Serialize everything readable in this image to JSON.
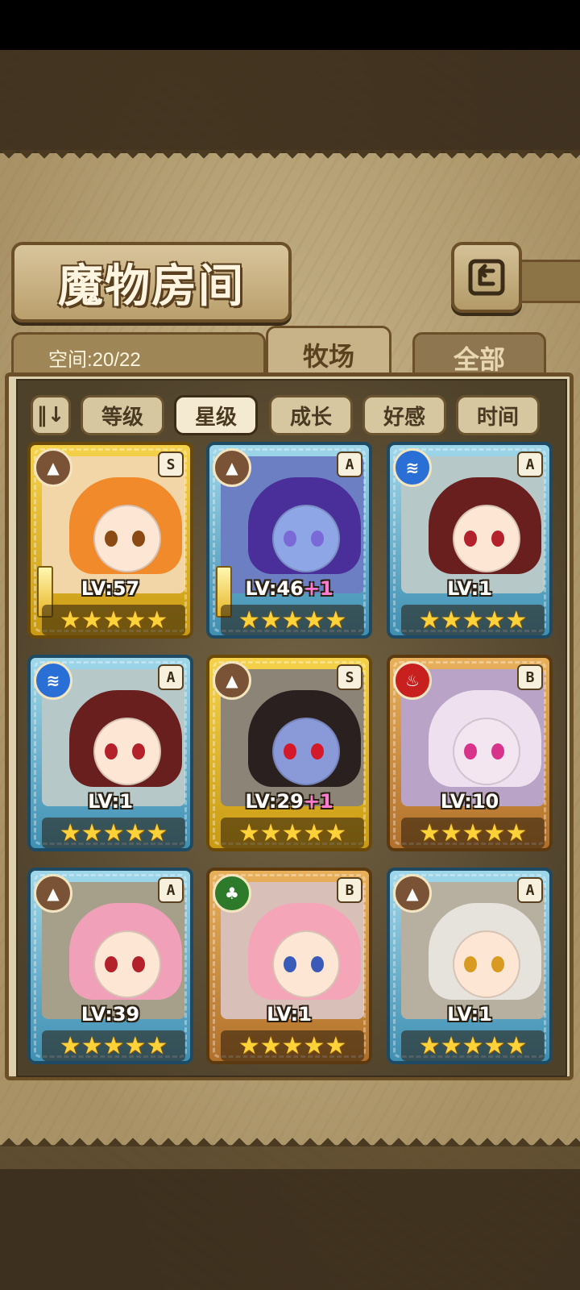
{
  "page": {
    "title": "魔物房间",
    "space_label": "空间:20/22",
    "tabs": [
      {
        "label": "牧场",
        "active": true
      },
      {
        "label": "全部",
        "active": false
      }
    ],
    "sort_buttons": [
      {
        "label": "等级",
        "active": false
      },
      {
        "label": "星级",
        "active": true
      },
      {
        "label": "成长",
        "active": false
      },
      {
        "label": "好感",
        "active": false
      },
      {
        "label": "时间",
        "active": false
      }
    ],
    "sort_toggle_icon": "sort-order-icon"
  },
  "monsters": [
    {
      "level": "LV:57",
      "bonus": "",
      "rank": "S",
      "element": "earth",
      "frame": "gold",
      "stars": "★★★★★",
      "weapon": true,
      "hair": "#f08a2a",
      "eye": "#8b4a13"
    },
    {
      "level": "LV:46",
      "bonus": "+1",
      "rank": "A",
      "element": "earth",
      "frame": "blue",
      "stars": "★★★★★",
      "weapon": true,
      "hair": "#4a2e9a",
      "eye": "#7a6ad8"
    },
    {
      "level": "LV:1",
      "bonus": "",
      "rank": "A",
      "element": "water",
      "frame": "blue",
      "stars": "★★★★★",
      "weapon": false,
      "hair": "#6a1f1f",
      "eye": "#c8202a"
    },
    {
      "level": "LV:1",
      "bonus": "",
      "rank": "A",
      "element": "water",
      "frame": "blue",
      "stars": "★★★★★",
      "weapon": false,
      "hair": "#6a1f1f",
      "eye": "#c8202a"
    },
    {
      "level": "LV:29",
      "bonus": "+1",
      "rank": "S",
      "element": "earth",
      "frame": "gold",
      "stars": "★★★★★",
      "weapon": false,
      "hair": "#2a2020",
      "eye": "#d41a2a"
    },
    {
      "level": "LV:10",
      "bonus": "",
      "rank": "B",
      "element": "fire",
      "frame": "orange",
      "stars": "★★★★★",
      "weapon": false,
      "hair": "#efe0f0",
      "eye": "#d8338a"
    },
    {
      "level": "LV:39",
      "bonus": "",
      "rank": "A",
      "element": "earth",
      "frame": "blue",
      "stars": "★★★★★",
      "weapon": false,
      "hair": "#f0a0b8",
      "eye": "#c8202a"
    },
    {
      "level": "LV:1",
      "bonus": "",
      "rank": "B",
      "element": "wood",
      "frame": "orange",
      "stars": "★★★★★",
      "weapon": false,
      "hair": "#f4a6b8",
      "eye": "#3a5ab8"
    },
    {
      "level": "LV:1",
      "bonus": "",
      "rank": "A",
      "element": "earth",
      "frame": "blue",
      "stars": "★★★★★",
      "weapon": false,
      "hair": "#e6e2dc",
      "eye": "#d89a20"
    }
  ],
  "colors": {
    "earth": "#7a5236",
    "water": "#2a6fd6",
    "fire": "#c81f1f",
    "wood": "#2d7a2a"
  }
}
